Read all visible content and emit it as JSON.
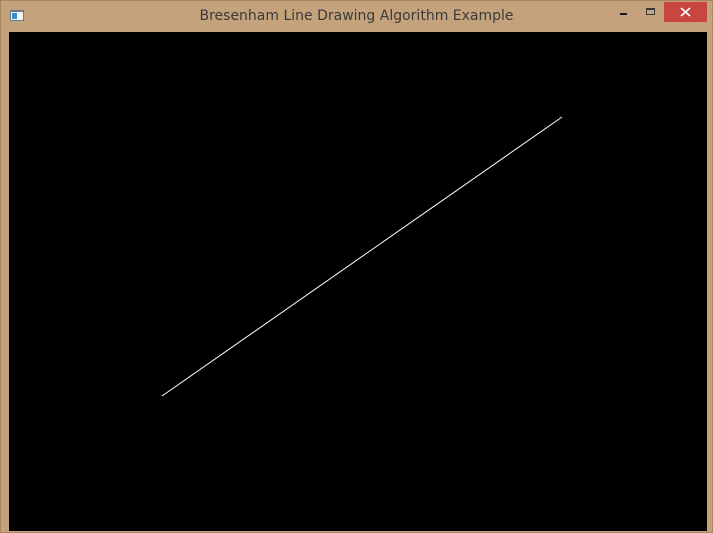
{
  "window": {
    "title": "Bresenham Line Drawing Algorithm Example",
    "frame_color": "#c4a27c",
    "canvas_color": "#000000",
    "close_button_color": "#c7463f"
  },
  "titlebar": {
    "app_icon": "app-window-icon",
    "minimize_icon": "minimize-icon",
    "maximize_icon": "maximize-icon",
    "close_icon": "close-icon"
  },
  "drawing": {
    "line_color": "#ffffff"
  }
}
